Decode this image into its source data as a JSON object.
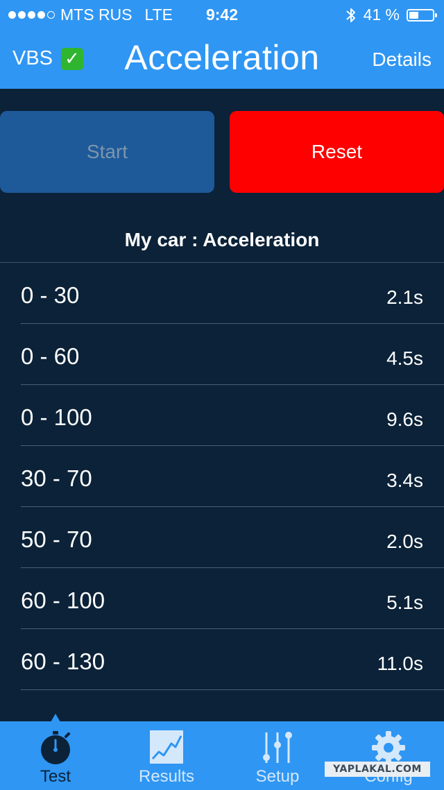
{
  "status_bar": {
    "carrier": "MTS RUS",
    "network": "LTE",
    "time": "9:42",
    "battery": "41 %",
    "battery_level": 0.41,
    "signal_bars_filled": 4,
    "signal_bars_total": 5
  },
  "nav": {
    "left_label": "VBS",
    "left_check": "✓",
    "title": "Acceleration",
    "right_label": "Details"
  },
  "buttons": {
    "start": "Start",
    "reset": "Reset"
  },
  "section_title": "My car : Acceleration",
  "results": [
    {
      "range": "0 - 30",
      "time": "2.1s"
    },
    {
      "range": "0 - 60",
      "time": "4.5s"
    },
    {
      "range": "0 - 100",
      "time": "9.6s"
    },
    {
      "range": "30 - 70",
      "time": "3.4s"
    },
    {
      "range": "50 - 70",
      "time": "2.0s"
    },
    {
      "range": "60 - 100",
      "time": "5.1s"
    },
    {
      "range": "60 - 130",
      "time": "11.0s"
    }
  ],
  "tabs": [
    {
      "label": "Test",
      "icon": "stopwatch-icon",
      "active": true
    },
    {
      "label": "Results",
      "icon": "chart-icon",
      "active": false
    },
    {
      "label": "Setup",
      "icon": "sliders-icon",
      "active": false
    },
    {
      "label": "Config",
      "icon": "gear-icon",
      "active": false
    }
  ],
  "watermark": "YAPLAKAL.COM",
  "colors": {
    "bar_blue": "#2f96f3",
    "background": "#0b2238",
    "reset_red": "#ff0000",
    "start_blue": "#1e5a9a"
  }
}
